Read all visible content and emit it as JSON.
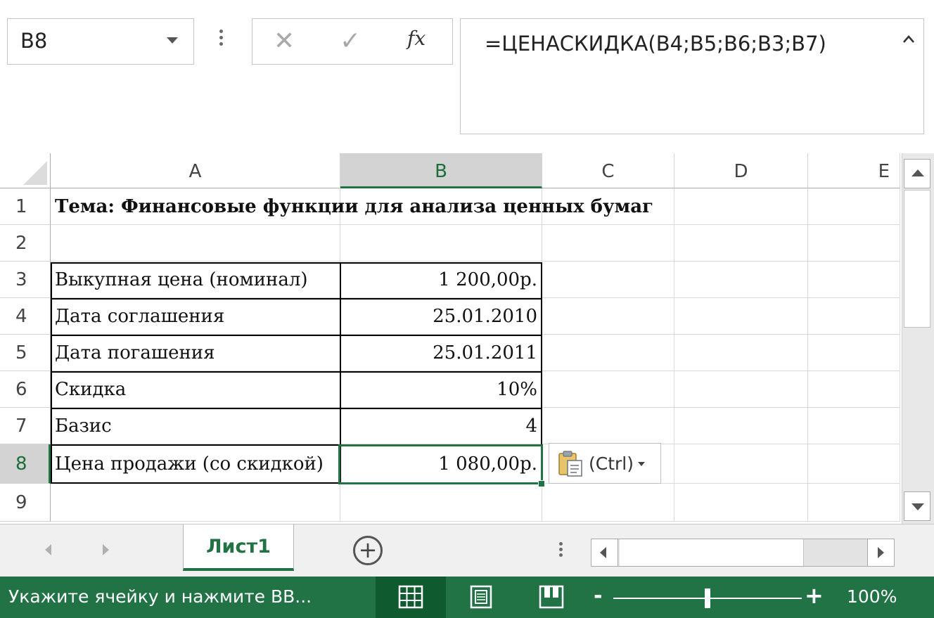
{
  "formula_bar": {
    "name_box": "B8",
    "formula": "=ЦЕНАСКИДКА(B4;B5;B6;B3;B7)",
    "cancel_icon": "✕",
    "enter_icon": "✓",
    "fx_label": "fx"
  },
  "columns": [
    "A",
    "B",
    "C",
    "D",
    "E"
  ],
  "active_column": "B",
  "rows": [
    "1",
    "2",
    "3",
    "4",
    "5",
    "6",
    "7",
    "8",
    "9"
  ],
  "active_row": "8",
  "cells": {
    "A1": "Тема: Финансовые функции для анализа ценных бумаг",
    "A3": "Выкупная цена (номинал)",
    "B3": "1 200,00р.",
    "A4": "Дата соглашения",
    "B4": "25.01.2010",
    "A5": "Дата погашения",
    "B5": "25.01.2011",
    "A6": "Скидка",
    "B6": "10%",
    "A7": "Базис",
    "B7": "4",
    "A8": "Цена продажи (со скидкой)",
    "B8": "1 080,00р."
  },
  "paste_options": {
    "label": "(Ctrl)"
  },
  "sheet_tabs": {
    "active": "Лист1",
    "add_symbol": "+"
  },
  "status_bar": {
    "text": "Укажите ячейку и нажмите ВВ...",
    "zoom_out": "-",
    "zoom_in": "+",
    "zoom_level": "100%",
    "zoom_fraction": 0.5
  },
  "colors": {
    "accent": "#217346",
    "selection": "#217346",
    "header_active_bg": "#d3d3d3"
  }
}
